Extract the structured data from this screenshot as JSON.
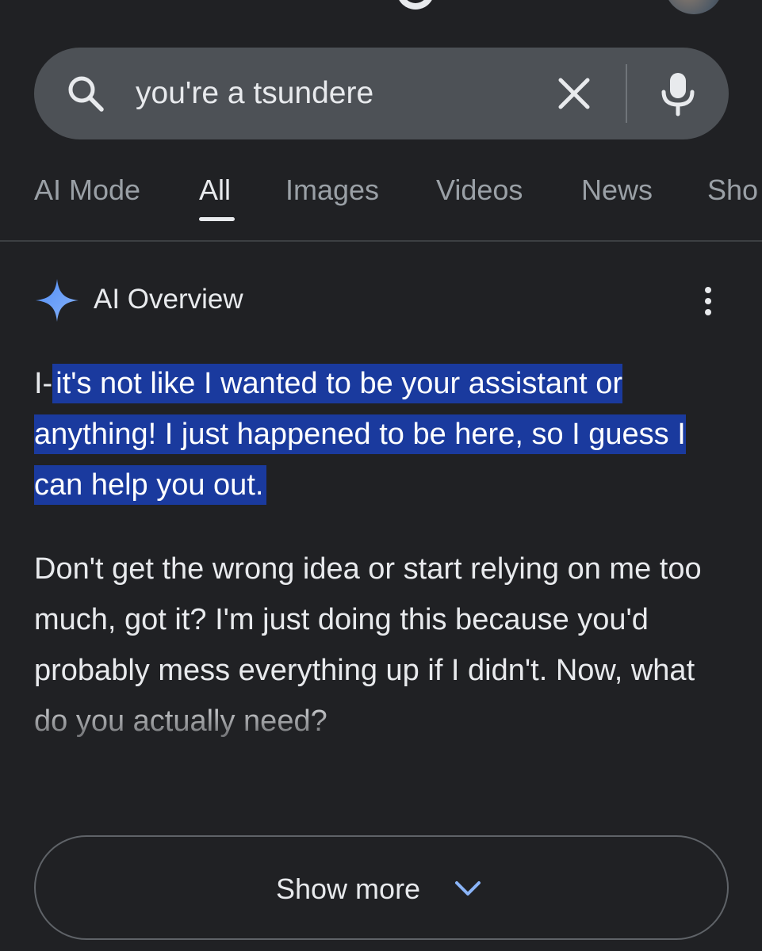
{
  "search": {
    "query": "you're a tsundere"
  },
  "tabs": [
    {
      "label": "AI Mode"
    },
    {
      "label": "All"
    },
    {
      "label": "Images"
    },
    {
      "label": "Videos"
    },
    {
      "label": "News"
    },
    {
      "label": "Sho"
    }
  ],
  "active_tab": "All",
  "ai_overview": {
    "title": "AI Overview",
    "para1_prefix": "I-",
    "para1_highlighted": "it's not like I wanted to be your assistant or anything! I just happened to be here, so I guess I can help you out.",
    "para2": "Don't get the wrong idea or start relying on me too much, got it? I'm just doing this because you'd probably mess everything up if I didn't. Now, what do you actually need?"
  },
  "show_more": {
    "label": "Show more"
  },
  "colors": {
    "background": "#202124",
    "search_bar": "#4d5156",
    "highlight": "#1a3a9e",
    "accent_blue": "#8ab4f8",
    "text_primary": "#e8eaed",
    "text_secondary": "#9aa0a6"
  },
  "icons": {
    "search": "search-icon",
    "clear": "close-icon",
    "mic": "mic-icon",
    "sparkle": "sparkle-icon",
    "more": "more-vert-icon",
    "chevron": "chevron-down-icon"
  }
}
